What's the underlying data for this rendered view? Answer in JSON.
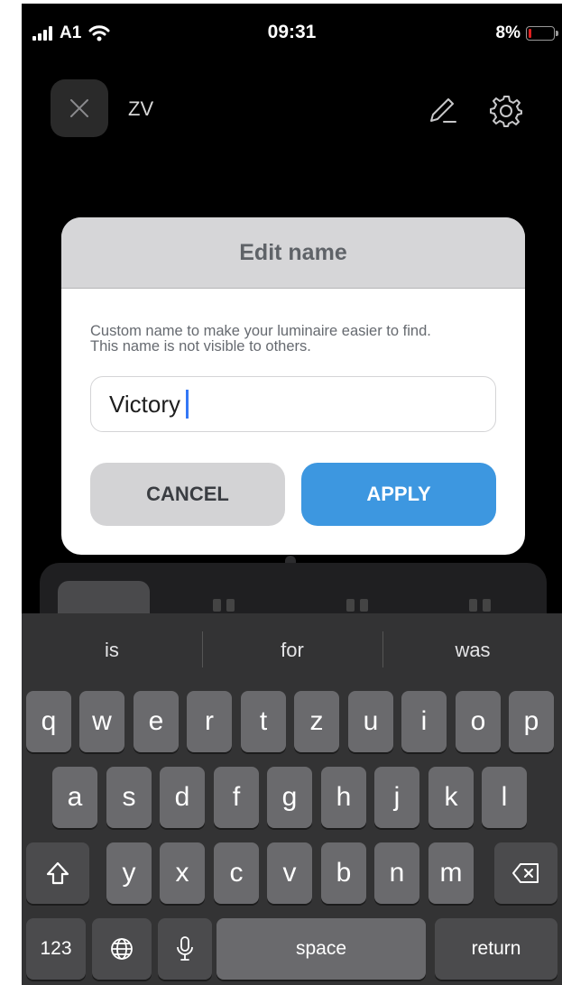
{
  "status_bar": {
    "carrier": "A1",
    "time": "09:31",
    "battery_percent": "8%",
    "icons": [
      "signal-icon",
      "wifi-icon",
      "battery-icon"
    ]
  },
  "header": {
    "title": "ZV",
    "icons": [
      "close-icon",
      "pencil-icon",
      "gear-icon"
    ]
  },
  "dialog": {
    "title": "Edit name",
    "description_line1": "Custom name to make your luminaire easier to find.",
    "description_line2": "This name is not visible to others.",
    "input_value": "Victory",
    "cancel_label": "CANCEL",
    "apply_label": "APPLY"
  },
  "keyboard": {
    "suggestions": [
      "is",
      "for",
      "was"
    ],
    "row1": [
      "q",
      "w",
      "e",
      "r",
      "t",
      "z",
      "u",
      "i",
      "o",
      "p"
    ],
    "row2": [
      "a",
      "s",
      "d",
      "f",
      "g",
      "h",
      "j",
      "k",
      "l"
    ],
    "row3": [
      "y",
      "x",
      "c",
      "v",
      "b",
      "n",
      "m"
    ],
    "numbers_label": "123",
    "space_label": "space",
    "return_label": "return",
    "icons": [
      "shift-icon",
      "delete-icon",
      "globe-icon",
      "microphone-icon"
    ]
  },
  "colors": {
    "accent": "#3d97e0",
    "cursor": "#3478f6",
    "dialog_header": "#d6d6d8",
    "keyboard_bg": "#333334",
    "key": "#6a6a6d"
  }
}
